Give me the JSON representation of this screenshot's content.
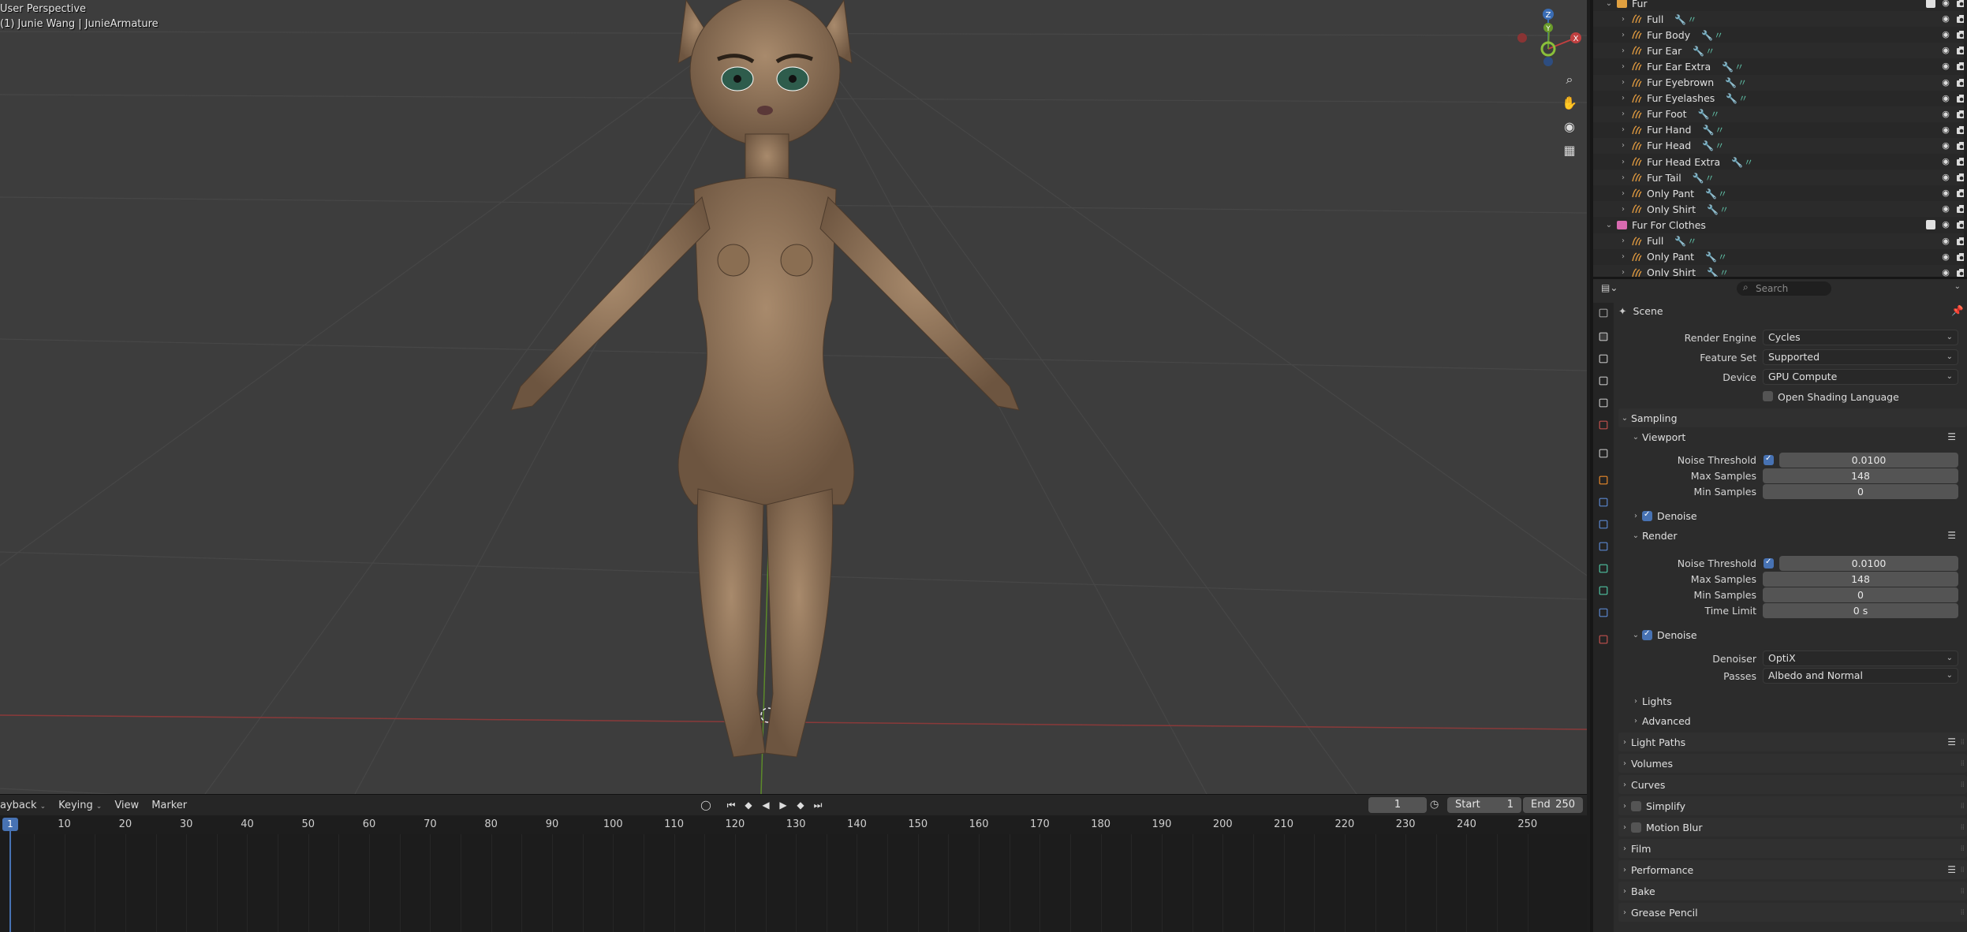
{
  "viewport": {
    "perspective_label": "User Perspective",
    "object_label": "(1) Junie Wang | JunieArmature",
    "gizmo": {
      "z": "Z",
      "y": "Y",
      "x": "X"
    },
    "nav_icons": [
      "zoom-icon",
      "pan-hand-icon",
      "camera-icon",
      "grid-icon"
    ]
  },
  "timeline": {
    "menus": [
      {
        "label": "ayback"
      },
      {
        "label": "Keying"
      },
      {
        "label": "View"
      },
      {
        "label": "Marker"
      }
    ],
    "current_frame": "1",
    "start_label": "Start",
    "start_value": "1",
    "end_label": "End",
    "end_value": "250",
    "ruler": [
      "1",
      "10",
      "20",
      "30",
      "40",
      "50",
      "60",
      "70",
      "80",
      "90",
      "100",
      "110",
      "120",
      "130",
      "140",
      "150",
      "160",
      "170",
      "180",
      "190",
      "200",
      "210",
      "220",
      "230",
      "240",
      "250"
    ]
  },
  "outliner": {
    "rows": [
      {
        "type": "collection",
        "label": "Fur",
        "color": "#e0a040"
      },
      {
        "type": "hair",
        "label": "Full"
      },
      {
        "type": "hair",
        "label": "Fur Body"
      },
      {
        "type": "hair",
        "label": "Fur Ear"
      },
      {
        "type": "hair",
        "label": "Fur Ear Extra"
      },
      {
        "type": "hair",
        "label": "Fur Eyebrown"
      },
      {
        "type": "hair",
        "label": "Fur Eyelashes"
      },
      {
        "type": "hair",
        "label": "Fur Foot"
      },
      {
        "type": "hair",
        "label": "Fur Hand"
      },
      {
        "type": "hair",
        "label": "Fur Head"
      },
      {
        "type": "hair",
        "label": "Fur Head Extra"
      },
      {
        "type": "hair",
        "label": "Fur Tail"
      },
      {
        "type": "hair",
        "label": "Only Pant"
      },
      {
        "type": "hair",
        "label": "Only Shirt"
      },
      {
        "type": "collection",
        "label": "Fur For Clothes",
        "color": "#d86ab0"
      },
      {
        "type": "hair",
        "label": "Full"
      },
      {
        "type": "hair",
        "label": "Only Pant"
      },
      {
        "type": "hair",
        "label": "Only Shirt"
      }
    ]
  },
  "properties": {
    "search_placeholder": "Search",
    "context": "Scene",
    "render_engine_label": "Render Engine",
    "render_engine_value": "Cycles",
    "feature_set_label": "Feature Set",
    "feature_set_value": "Supported",
    "device_label": "Device",
    "device_value": "GPU Compute",
    "osl_label": "Open Shading Language",
    "sampling": {
      "title": "Sampling",
      "viewport": {
        "title": "Viewport",
        "noise_threshold_label": "Noise Threshold",
        "noise_threshold_value": "0.0100",
        "max_samples_label": "Max Samples",
        "max_samples_value": "148",
        "min_samples_label": "Min Samples",
        "min_samples_value": "0",
        "denoise_label": "Denoise"
      },
      "render": {
        "title": "Render",
        "noise_threshold_label": "Noise Threshold",
        "noise_threshold_value": "0.0100",
        "max_samples_label": "Max Samples",
        "max_samples_value": "148",
        "min_samples_label": "Min Samples",
        "min_samples_value": "0",
        "time_limit_label": "Time Limit",
        "time_limit_value": "0 s",
        "denoise_label": "Denoise",
        "denoiser_label": "Denoiser",
        "denoiser_value": "OptiX",
        "passes_label": "Passes",
        "passes_value": "Albedo and Normal"
      },
      "lights_label": "Lights",
      "advanced_label": "Advanced"
    },
    "panels": [
      "Light Paths",
      "Volumes",
      "Curves",
      "Simplify",
      "Motion Blur",
      "Film",
      "Performance",
      "Bake",
      "Grease Pencil"
    ],
    "accent_color": "#4772b3"
  }
}
